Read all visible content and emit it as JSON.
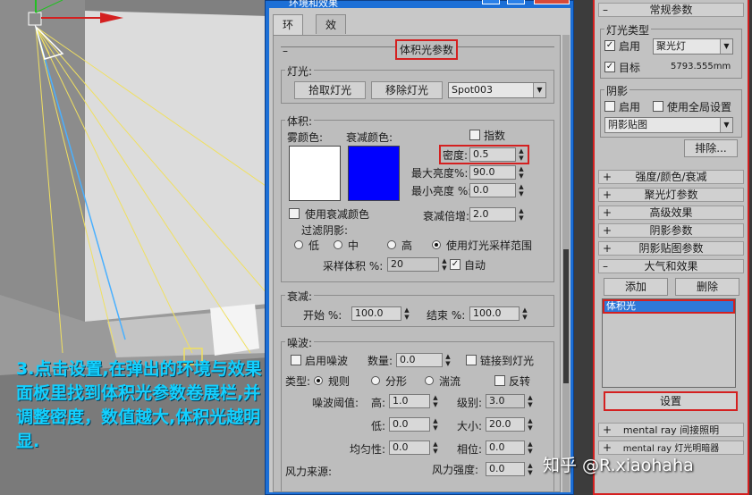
{
  "dialog": {
    "title": "环境和效果",
    "tabs": [
      {
        "label": "环境"
      },
      {
        "label": "效果"
      }
    ],
    "rollout_title": "体积光参数",
    "lights": {
      "group": "灯光:",
      "pick_button": "拾取灯光",
      "remove_button": "移除灯光",
      "light_name": "Spot003"
    },
    "volume": {
      "group": "体积:",
      "fog_color_label": "雾颜色:",
      "atten_color_label": "衰减颜色:",
      "fog_color": "#ffffff",
      "atten_color": "#0000ff",
      "exponential_label": "指数",
      "density_label": "密度:",
      "density_value": "0.5",
      "max_light_label": "最大亮度%:",
      "max_light_value": "90.0",
      "min_light_label": "最小亮度 %:",
      "min_light_value": "0.0",
      "use_atten_color_label": "使用衰减颜色",
      "atten_mult_label": "衰减倍增:",
      "atten_mult_value": "2.0",
      "filter_shadows_label": "过滤阴影:",
      "filter_low": "低",
      "filter_medium": "中",
      "filter_high": "高",
      "filter_use_light": "使用灯光采样范围",
      "sample_volume_label": "采样体积 %:",
      "sample_volume_value": "20",
      "auto_label": "自动"
    },
    "attenuation": {
      "group": "衰减:",
      "start_label": "开始 %:",
      "start_value": "100.0",
      "end_label": "结束 %:",
      "end_value": "100.0"
    },
    "noise": {
      "group": "噪波:",
      "enable_label": "启用噪波",
      "amount_label": "数量:",
      "amount_value": "0.0",
      "link_light_label": "链接到灯光",
      "type_label": "类型:",
      "type_regular": "规则",
      "type_fractal": "分形",
      "type_turbulence": "湍流",
      "invert_label": "反转",
      "threshold_label": "噪波阈值:",
      "high_label": "高:",
      "high_value": "1.0",
      "levels_label": "级别:",
      "levels_value": "3.0",
      "low_label": "低:",
      "low_value": "0.0",
      "size_label": "大小:",
      "size_value": "20.0",
      "uniformity_label": "均匀性:",
      "uniformity_value": "0.0",
      "phase_label": "相位:",
      "phase_value": "0.0",
      "wind_source_label": "风力来源:",
      "wind_strength_label": "风力强度:",
      "wind_strength_value": "0.0"
    }
  },
  "command_panel": {
    "general_params": "常规参数",
    "light_type_group": "灯光类型",
    "on_label": "启用",
    "light_type": "聚光灯",
    "target_label": "目标",
    "target_distance": "5793.555mm",
    "shadows_group": "阴影",
    "shadows_on_label": "启用",
    "use_global_label": "使用全局设置",
    "shadow_type": "阴影贴图",
    "exclude_button": "排除...",
    "rollouts": [
      {
        "label": "强度/颜色/衰减"
      },
      {
        "label": "聚光灯参数"
      },
      {
        "label": "高级效果"
      },
      {
        "label": "阴影参数"
      },
      {
        "label": "阴影贴图参数"
      }
    ],
    "atmos_title": "大气和效果",
    "add_button": "添加",
    "delete_button": "删除",
    "atmos_item": "体积光",
    "setup_button": "设置",
    "mr_indirect": "mental ray 间接照明",
    "mr_shader": "mental ray 灯光明暗器"
  },
  "caption": "3.点击设置,在弹出的环境与效果面板里找到体积光参数卷展栏,并调整密度，数值越大,体积光越明显.",
  "watermark": "知乎 @R.xiaohaha",
  "colors": {
    "highlight": "#d42020",
    "caption": "#12d0ff",
    "dialog_frame": "#1c6fd6",
    "selection": "#2f78d8"
  }
}
